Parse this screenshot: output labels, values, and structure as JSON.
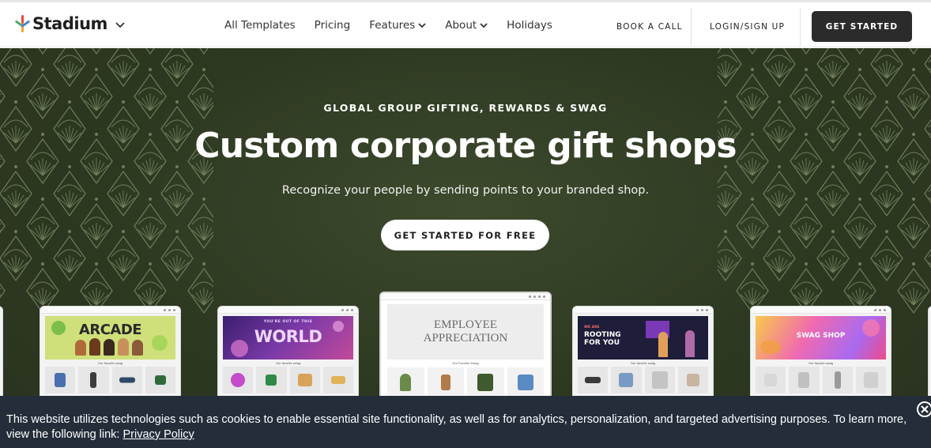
{
  "brand": {
    "name": "Stadium",
    "mark_colors": [
      "#e8473f",
      "#f4a338",
      "#4aa86b",
      "#4b7fd6"
    ]
  },
  "nav": {
    "items": [
      {
        "label": "All Templates",
        "dropdown": false
      },
      {
        "label": "Pricing",
        "dropdown": false
      },
      {
        "label": "Features",
        "dropdown": true
      },
      {
        "label": "About",
        "dropdown": true
      },
      {
        "label": "Holidays",
        "dropdown": false
      }
    ],
    "book_call": "BOOK A CALL",
    "login": "LOGIN/SIGN UP",
    "get_started": "GET STARTED"
  },
  "hero": {
    "eyebrow": "GLOBAL GROUP GIFTING, REWARDS & SWAG",
    "headline": "Custom corporate gift shops",
    "subline": "Recognize your people by sending points to your branded shop.",
    "cta": "GET STARTED FOR FREE",
    "background": "#2d3821",
    "pattern_color": "#6f7e5a"
  },
  "shops": [
    {
      "banner_text": "ARCADE",
      "banner_color": "#cfe07a",
      "text_color": "#2a2a2a",
      "caption": "Our favorite swag",
      "product_colors": [
        "#4a6fb0",
        "#3c3c3c",
        "#2e4a6b",
        "#2f6b3a"
      ]
    },
    {
      "banner_text": "WORLD",
      "small_text": "YOU'RE OUT OF THIS",
      "banner_color": "#5b2a8a",
      "text_color": "#f0d7ff",
      "caption": "Our favorite swag",
      "product_colors": [
        "#c44bc9",
        "#2f8a4a",
        "#d9a25a",
        "#e0b35a"
      ]
    },
    {
      "banner_text": "EMPLOYEE APPRECIATION",
      "banner_color": "#ededed",
      "text_color": "#6a6a6a",
      "caption": "Our Favorite Swag",
      "product_colors": [
        "#6a8a4a",
        "#b07a4a",
        "#3f5a2e",
        "#5a8ac4"
      ]
    },
    {
      "banner_text": "ROOTING FOR YOU",
      "small_text": "WE ARE",
      "banner_color": "#1e1e3a",
      "text_color": "#ffffff",
      "caption": "Our favorite swag",
      "product_colors": [
        "#3a3a3a",
        "#7a9ac4",
        "#c4c4c4",
        "#c8b4a0"
      ]
    },
    {
      "banner_text": "SWAG SHOP",
      "banner_color": "#f06ab0",
      "text_color": "#ffffff",
      "caption": "Our favorite swag",
      "product_colors": [
        "#d8d8d8",
        "#c0c0c0",
        "#9a9a9a",
        "#d0d0d0"
      ]
    }
  ],
  "cookie": {
    "text": "This website utilizes technologies such as cookies to enable essential site functionality, as well as for analytics, personalization, and targeted advertising purposes. To learn more, view the following link: ",
    "link": "Privacy Policy"
  }
}
